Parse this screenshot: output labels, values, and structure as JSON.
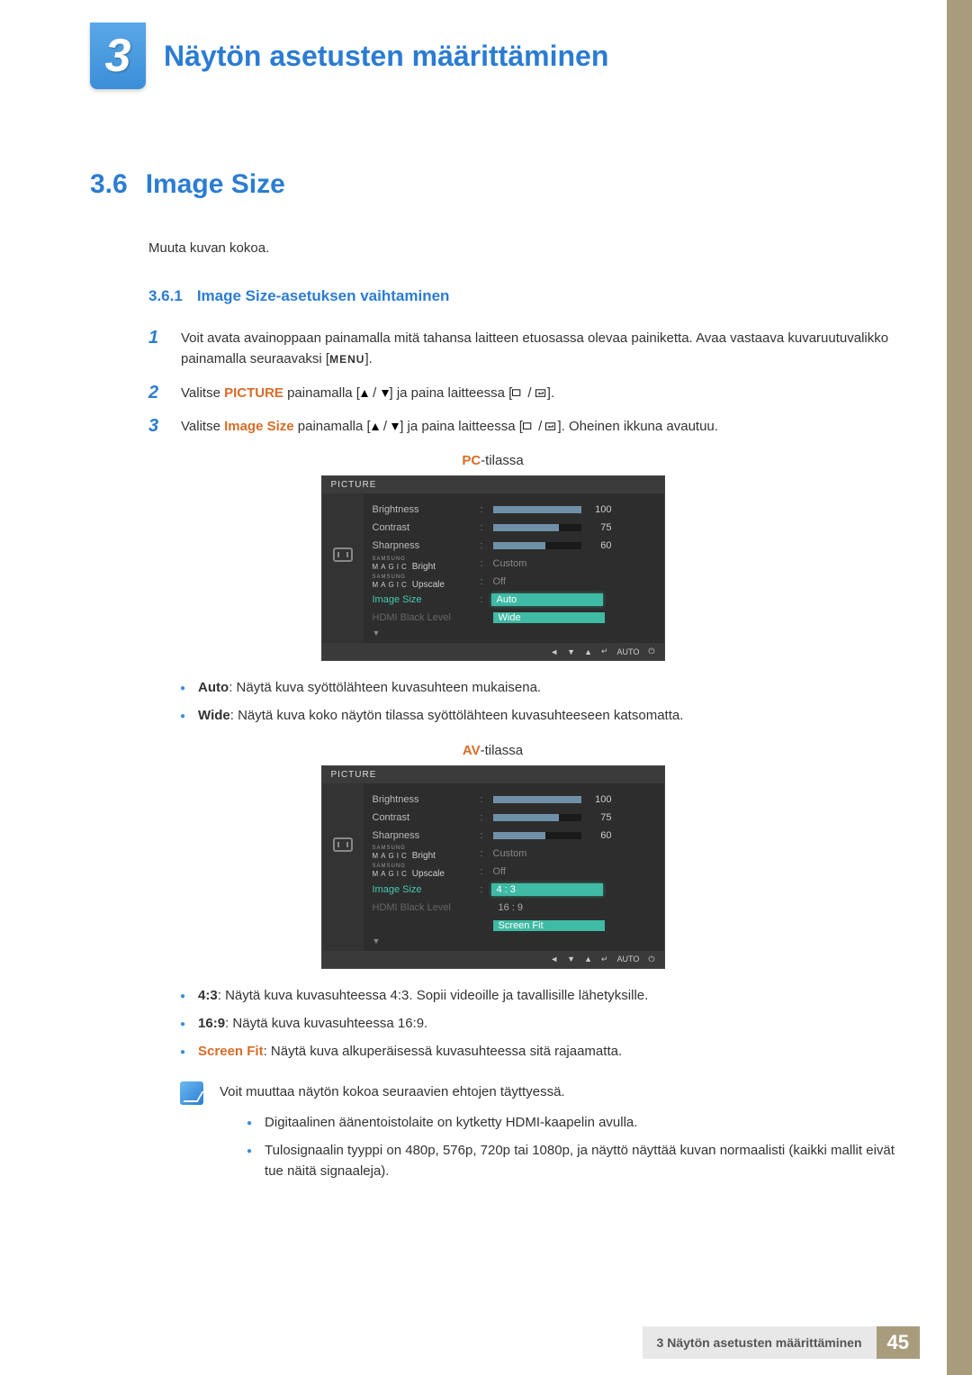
{
  "chapter": {
    "number": "3",
    "title": "Näytön asetusten määrittäminen"
  },
  "section": {
    "number": "3.6",
    "title": "Image Size",
    "intro": "Muuta kuvan kokoa."
  },
  "subsection": {
    "number": "3.6.1",
    "title": "Image Size-asetuksen vaihtaminen"
  },
  "steps": {
    "s1": {
      "num": "1",
      "text_a": "Voit avata avainoppaan painamalla mitä tahansa laitteen etuosassa olevaa painiketta. Avaa vastaava kuvaruutuvalikko painamalla seuraavaksi [",
      "menu": "MENU",
      "text_b": "]."
    },
    "s2": {
      "num": "2",
      "pre": "Valitse ",
      "picture": "PICTURE",
      "mid": " painamalla [",
      "mid2": "] ja paina laitteessa [",
      "end": "]."
    },
    "s3": {
      "num": "3",
      "pre": "Valitse ",
      "image": "Image Size",
      "mid": " painamalla [",
      "mid2": "] ja paina laitteessa [",
      "end": "]. Oheinen ikkuna avautuu."
    }
  },
  "modes": {
    "pc": {
      "prefix": "PC",
      "suffix": "-tilassa"
    },
    "av": {
      "prefix": "AV",
      "suffix": "-tilassa"
    }
  },
  "osd": {
    "title": "PICTURE",
    "rows": {
      "brightness": {
        "label": "Brightness",
        "value": "100",
        "pct": 100
      },
      "contrast": {
        "label": "Contrast",
        "value": "75",
        "pct": 75
      },
      "sharpness": {
        "label": "Sharpness",
        "value": "60",
        "pct": 60
      },
      "magic_bright": {
        "sm": "SAMSUNG",
        "mg": "MAGIC",
        "suf": "Bright",
        "val": "Custom"
      },
      "magic_upscale": {
        "sm": "SAMSUNG",
        "mg": "MAGIC",
        "suf": "Upscale",
        "val": "Off"
      },
      "image_size": {
        "label": "Image Size"
      },
      "hdmi": {
        "label": "HDMI Black Level"
      }
    },
    "pc_options": {
      "auto": "Auto",
      "wide": "Wide"
    },
    "av_options": {
      "r43": "4 : 3",
      "r169": "16 : 9",
      "fit": "Screen Fit"
    },
    "footer_auto": "AUTO"
  },
  "pc_bullets": {
    "auto": {
      "term": "Auto",
      "text": ": Näytä kuva syöttölähteen kuvasuhteen mukaisena."
    },
    "wide": {
      "term": "Wide",
      "text": ": Näytä kuva koko näytön tilassa syöttölähteen kuvasuhteeseen katsomatta."
    }
  },
  "av_bullets": {
    "r43": {
      "term": "4:3",
      "text": ": Näytä kuva kuvasuhteessa 4:3. Sopii videoille ja tavallisille lähetyksille."
    },
    "r169": {
      "term": "16:9",
      "text": ": Näytä kuva kuvasuhteessa 16:9."
    },
    "fit": {
      "term": "Screen Fit",
      "text": ": Näytä kuva alkuperäisessä kuvasuhteessa sitä rajaamatta."
    }
  },
  "note": {
    "lead": "Voit muuttaa näytön kokoa seuraavien ehtojen täyttyessä.",
    "b1": "Digitaalinen äänentoistolaite on kytketty HDMI-kaapelin avulla.",
    "b2": "Tulosignaalin tyyppi on 480p, 576p, 720p tai 1080p, ja näyttö näyttää kuvan normaalisti (kaikki mallit eivät tue näitä signaaleja)."
  },
  "footer": {
    "text": "3 Näytön asetusten määrittäminen",
    "page": "45"
  }
}
